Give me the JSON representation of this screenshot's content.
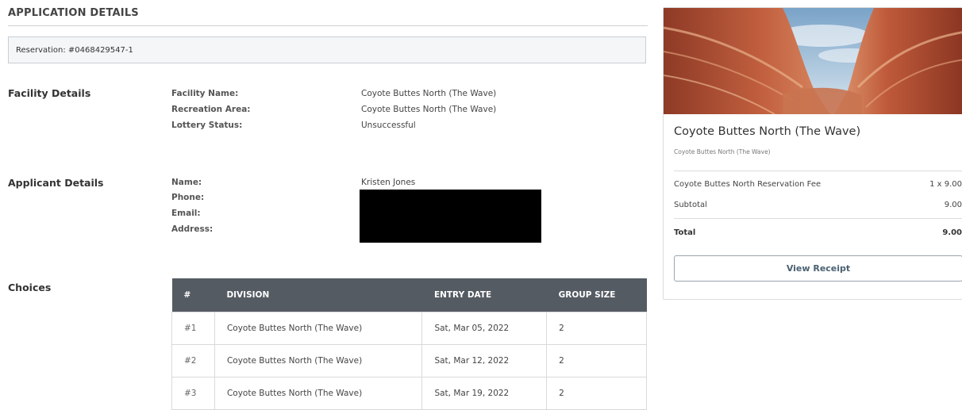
{
  "page": {
    "section_title": "APPLICATION DETAILS",
    "reservation": "Reservation: #0468429547-1"
  },
  "facility": {
    "group_label": "Facility Details",
    "fields": [
      {
        "label": "Facility Name:",
        "value": "Coyote Buttes North (The Wave)"
      },
      {
        "label": "Recreation Area:",
        "value": "Coyote Buttes North (The Wave)"
      },
      {
        "label": "Lottery Status:",
        "value": "Unsuccessful"
      }
    ]
  },
  "applicant": {
    "group_label": "Applicant Details",
    "fields": [
      {
        "label": "Name:",
        "value": "Kristen Jones"
      },
      {
        "label": "Phone:",
        "value": ""
      },
      {
        "label": "Email:",
        "value": ""
      },
      {
        "label": "Address:",
        "value": ""
      }
    ]
  },
  "choices": {
    "group_label": "Choices",
    "headers": [
      "#",
      "DIVISION",
      "ENTRY DATE",
      "GROUP SIZE"
    ],
    "rows": [
      [
        "#1",
        "Coyote Buttes North (The Wave)",
        "Sat, Mar 05, 2022",
        "2"
      ],
      [
        "#2",
        "Coyote Buttes North (The Wave)",
        "Sat, Mar 12, 2022",
        "2"
      ],
      [
        "#3",
        "Coyote Buttes North (The Wave)",
        "Sat, Mar 19, 2022",
        "2"
      ]
    ]
  },
  "summary": {
    "title": "Coyote Buttes North (The Wave)",
    "subtitle": "Coyote Buttes North (The Wave)",
    "fee_label": "Coyote Buttes North Reservation Fee",
    "fee_value": "1 x 9.00",
    "subtotal_label": "Subtotal",
    "subtotal_value": "9.00",
    "total_label": "Total",
    "total_value": "9.00",
    "receipt_button": "View Receipt"
  },
  "colors": {
    "table_header": "#555b63",
    "button_text": "#4a6172",
    "rock": "#b4533a",
    "sky": "#8fb3d1"
  }
}
